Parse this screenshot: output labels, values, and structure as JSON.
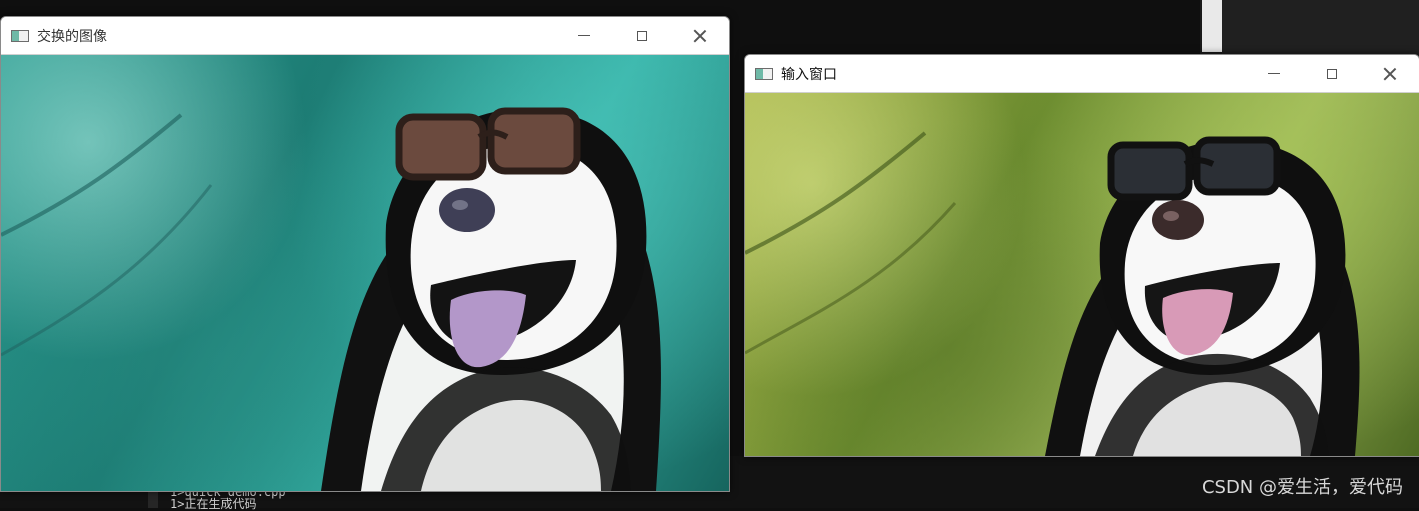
{
  "background": {
    "console_lines": [
      "1>quick_demo.cpp",
      "1>正在生成代码"
    ],
    "watermark": "CSDN @爱生活，爱代码"
  },
  "windows": {
    "swap": {
      "title": "交换的图像",
      "image_icon": "dog-with-sunglasses-image",
      "tint": "#2aa79a"
    },
    "input": {
      "title": "输入窗口",
      "image_icon": "dog-with-sunglasses-image",
      "tint": "#93ad45"
    }
  },
  "titlebar_icons": {
    "minimize": "minimize-icon",
    "maximize": "maximize-icon",
    "close": "close-icon"
  }
}
